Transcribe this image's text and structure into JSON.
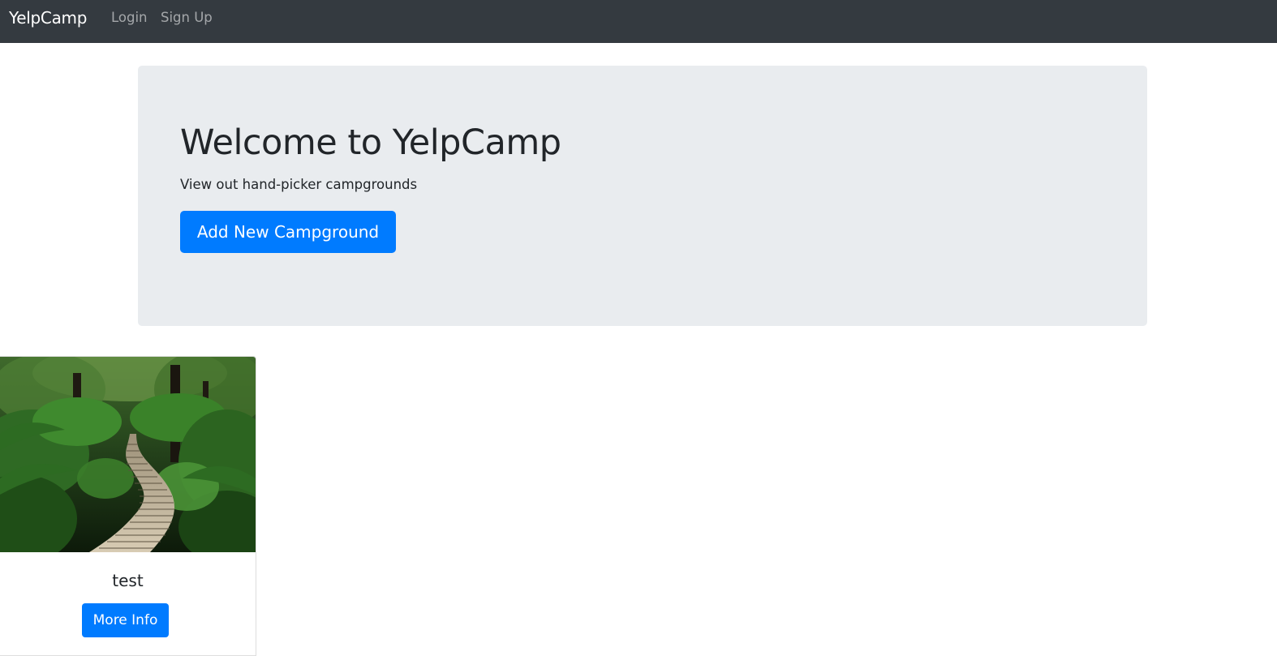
{
  "navbar": {
    "brand": "YelpCamp",
    "links": [
      "Login",
      "Sign Up"
    ]
  },
  "jumbotron": {
    "title": "Welcome to YelpCamp",
    "subtitle": "View out hand-picker campgrounds",
    "add_button_label": "Add New Campground"
  },
  "campgrounds": [
    {
      "name": "test",
      "button_label": "More Info",
      "image_icon": "jungle-boardwalk-photo"
    }
  ],
  "colors": {
    "navbar_bg": "#343a40",
    "primary": "#007bff",
    "jumbotron_bg": "#e9ecef"
  }
}
